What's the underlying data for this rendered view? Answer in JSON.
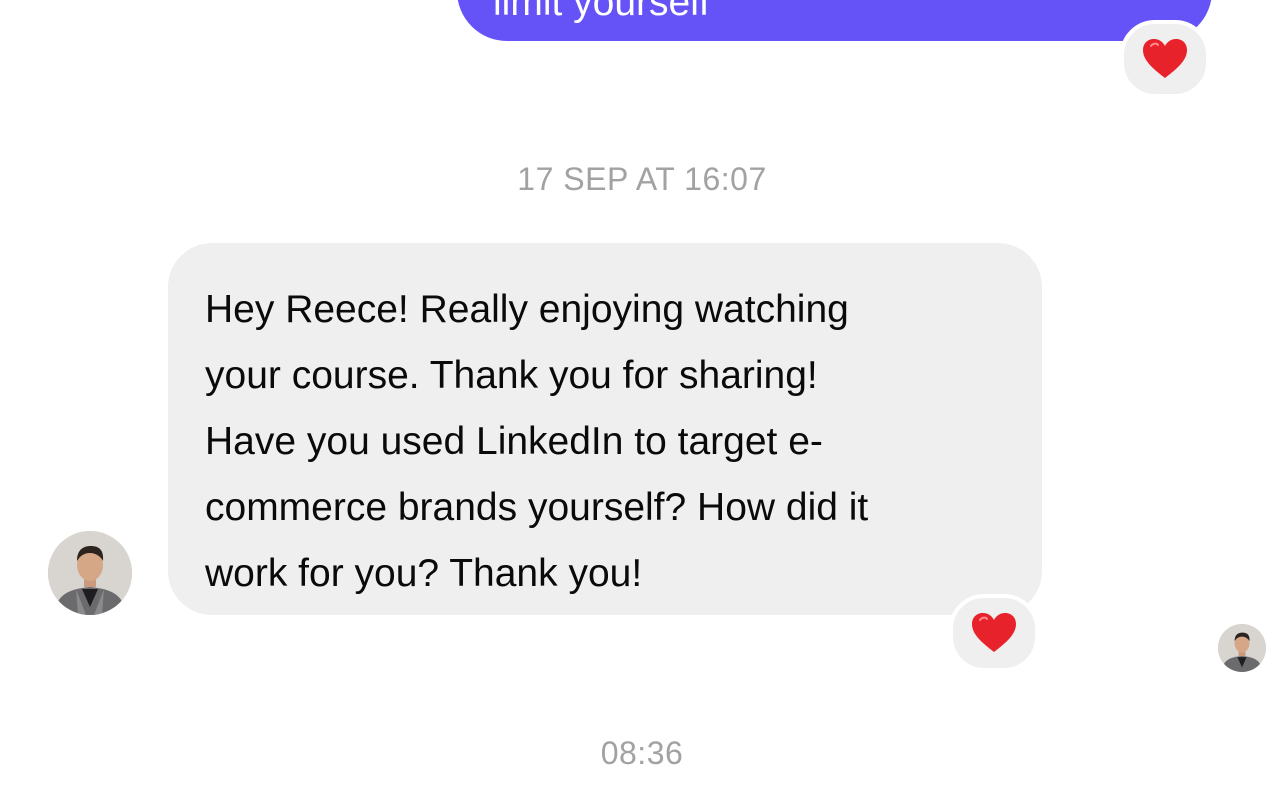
{
  "conversation": {
    "outgoing_message": {
      "text_fragment": "limit yourself",
      "reaction_icon": "red-heart-icon"
    },
    "timestamps": {
      "first": "17 SEP AT 16:07",
      "second": "08:36"
    },
    "incoming_message": {
      "text": "Hey Reece! Really enjoying watching\nyour course. Thank you for sharing!\nHave you used LinkedIn to target e-\ncommerce brands yourself? How did it\nwork for you? Thank you!",
      "reaction_icon": "red-heart-icon"
    },
    "sender_avatar": "avatar-photo",
    "read_receipt_avatar": "avatar-photo"
  },
  "colors": {
    "outgoing_bubble": "#6553f7",
    "incoming_bubble": "#efefef",
    "timestamp_text": "#a2a2a2",
    "heart": "#e8222b"
  }
}
